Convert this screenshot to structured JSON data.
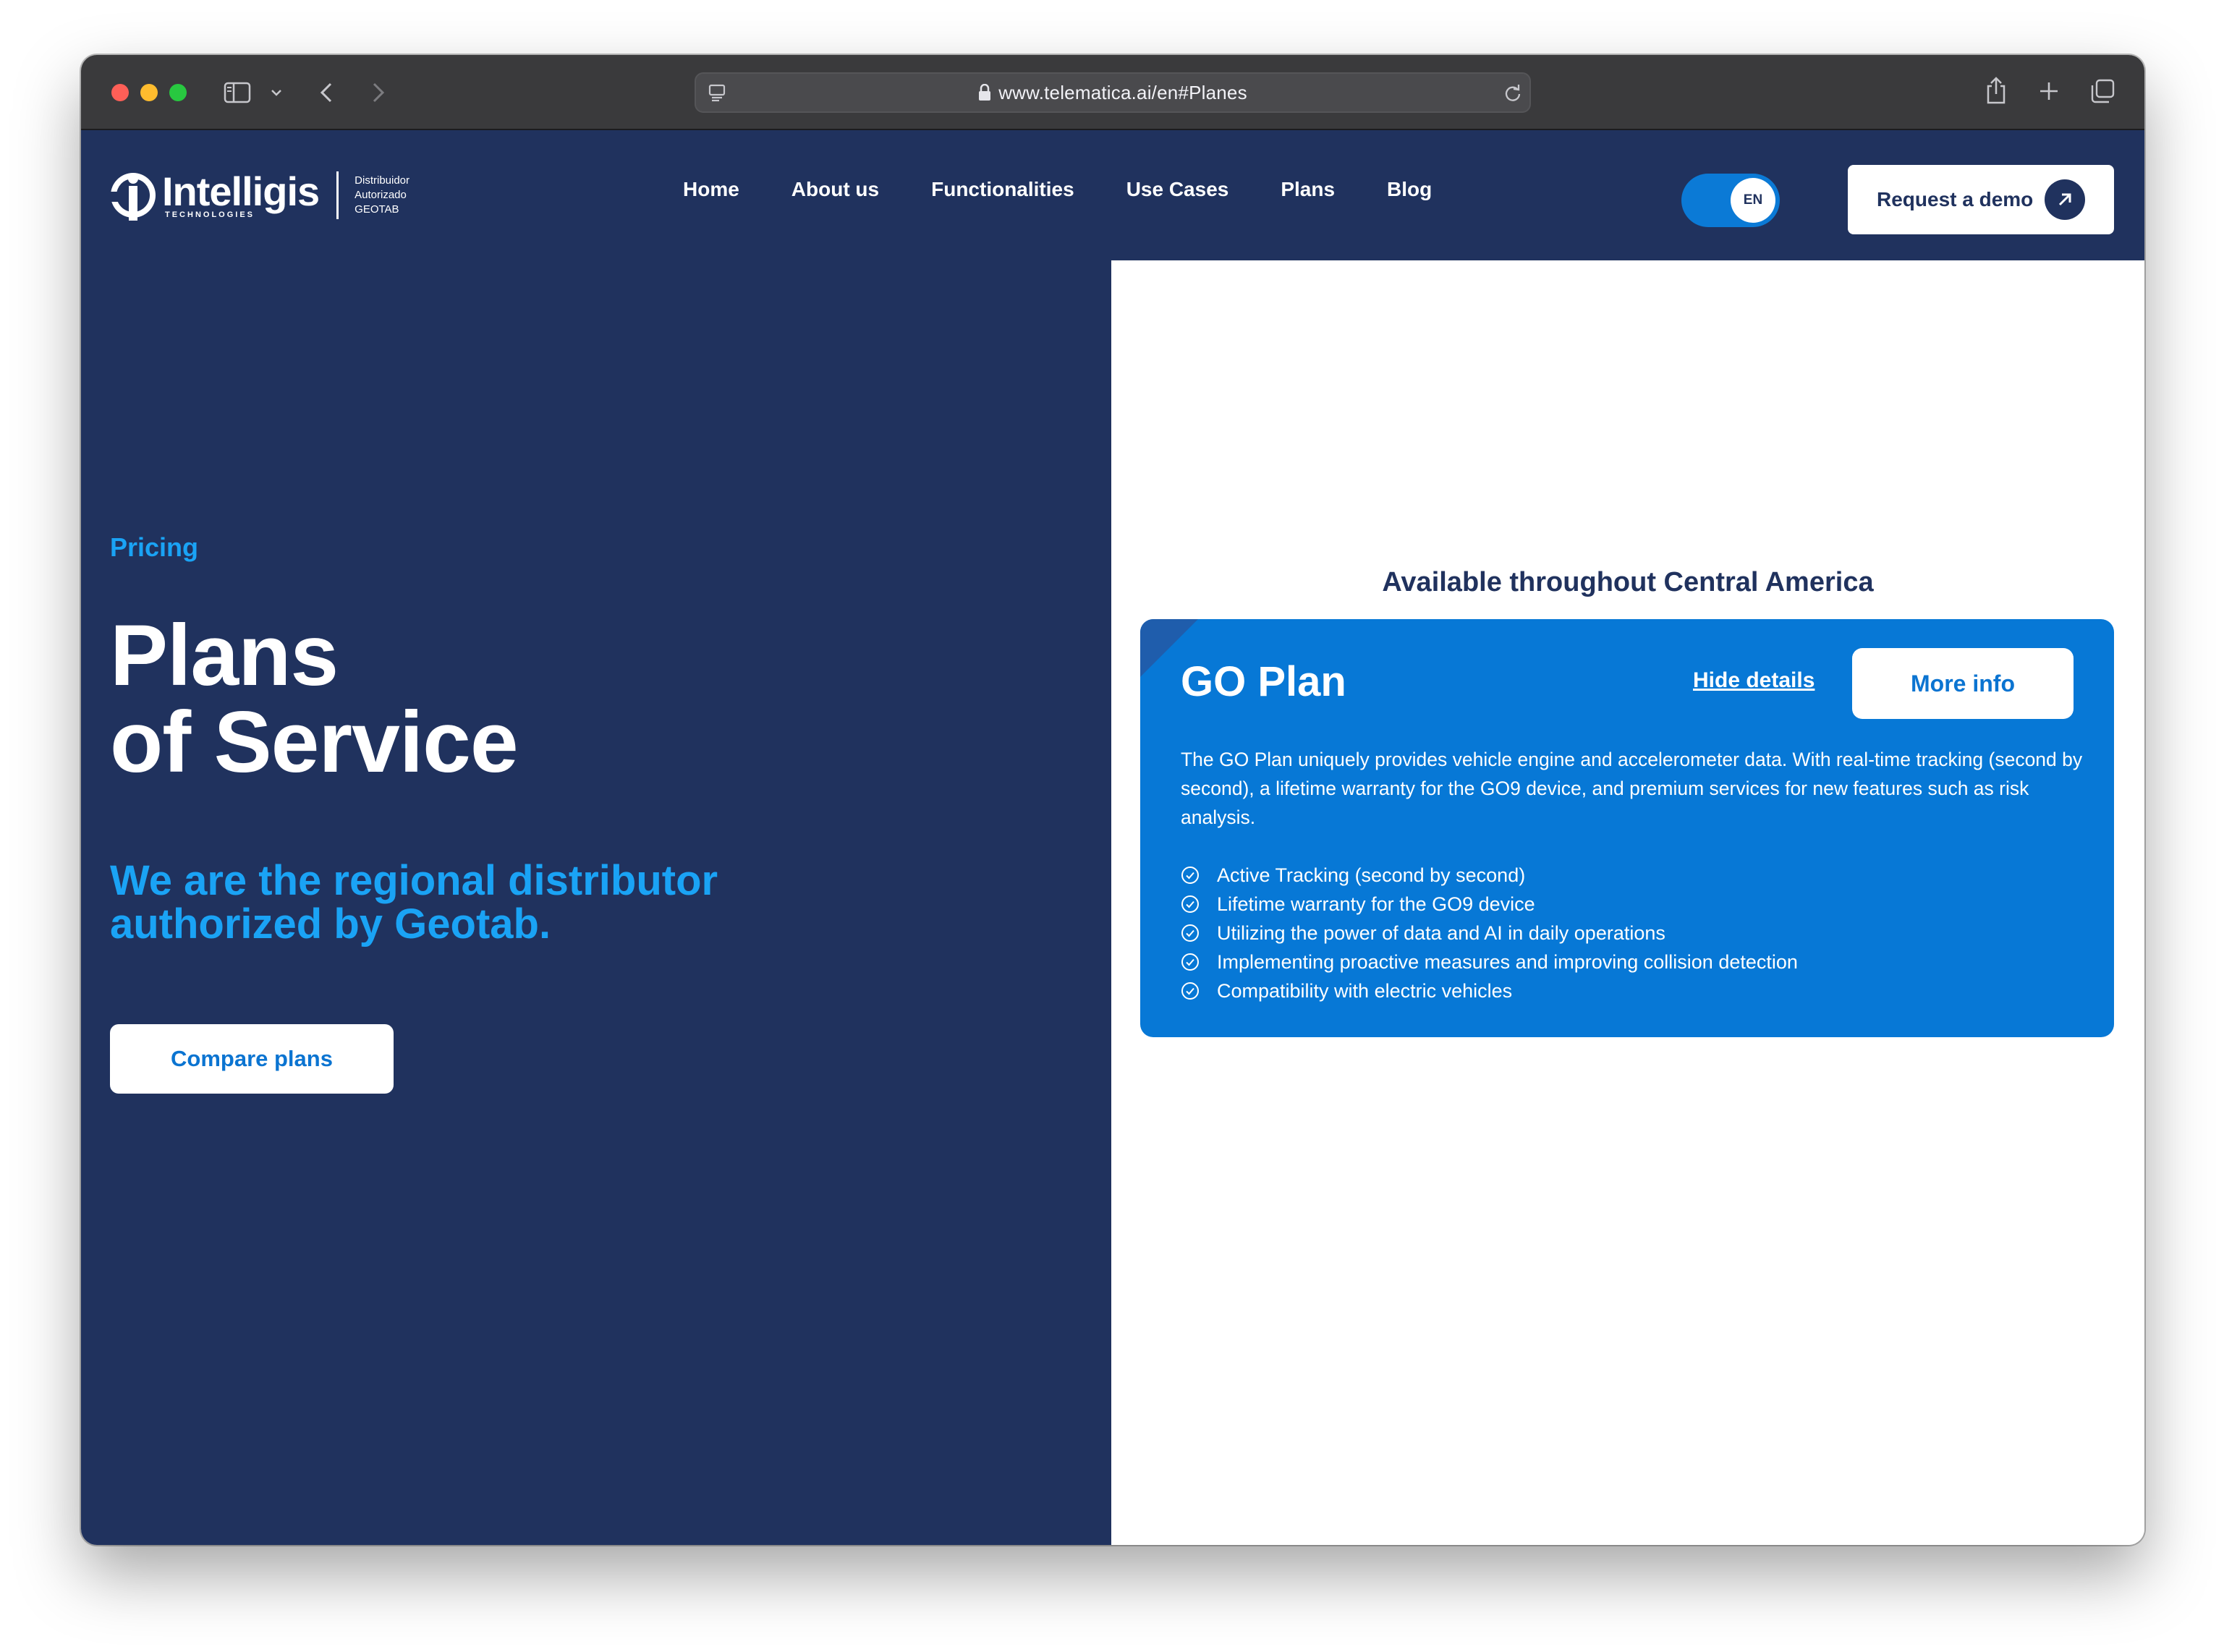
{
  "browser": {
    "url": "www.telematica.ai/en#Planes"
  },
  "brand": {
    "name": "Intelligis",
    "sub": "TECHNOLOGIES",
    "dist_line1": "Distribuidor",
    "dist_line2": "Autorizado",
    "dist_line3": "GEOTAB"
  },
  "nav": {
    "items": [
      {
        "label": "Home"
      },
      {
        "label": "About us"
      },
      {
        "label": "Functionalities"
      },
      {
        "label": "Use Cases"
      },
      {
        "label": "Plans"
      },
      {
        "label": "Blog"
      }
    ],
    "language": "EN",
    "demo_label": "Request a demo"
  },
  "hero": {
    "eyebrow": "Pricing",
    "title_line1": "Plans",
    "title_line2": "of Service",
    "subtitle_line1": "We are the regional distributor",
    "subtitle_line2": "authorized by Geotab.",
    "cta": "Compare plans"
  },
  "plans": {
    "heading": "Available throughout Central America",
    "card": {
      "title": "GO Plan",
      "hide_details": "Hide details",
      "more_info": "More info",
      "description": "The GO Plan uniquely provides vehicle engine and accelerometer data. With real-time tracking (second by second), a lifetime warranty for the GO9 device, and premium services for new features such as risk analysis.",
      "features": [
        "Active Tracking (second by second)",
        "Lifetime warranty for the GO9 device",
        "Utilizing the power of data and AI in daily operations",
        "Implementing proactive measures and improving collision detection",
        "Compatibility with electric vehicles"
      ]
    }
  },
  "colors": {
    "navy": "#20325e",
    "accent_blue": "#1aa3f5",
    "card_blue": "#0778d6",
    "toggle_blue": "#0b7ad6"
  },
  "icons": [
    "sidebar-icon",
    "chevron-down-icon",
    "back-icon",
    "forward-icon",
    "reader-icon",
    "lock-icon",
    "reload-icon",
    "share-icon",
    "new-tab-icon",
    "tabs-icon",
    "arrow-up-right-icon",
    "check-circle-icon"
  ]
}
